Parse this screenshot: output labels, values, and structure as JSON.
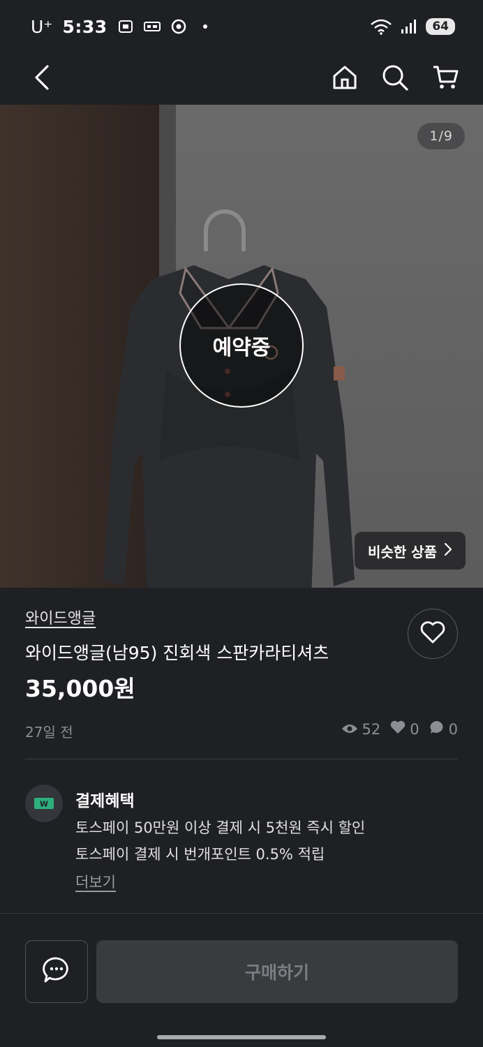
{
  "status_bar": {
    "carrier": "U⁺",
    "time": "5:33",
    "battery": "64"
  },
  "nav": {
    "back_icon": "chevron-left-icon",
    "home_icon": "home-icon",
    "search_icon": "search-icon",
    "cart_icon": "cart-icon"
  },
  "gallery": {
    "counter": "1/9",
    "status_overlay": "예약중",
    "similar_button": "비슷한 상품"
  },
  "product": {
    "brand": "와이드앵글",
    "title": "와이드앵글(남95) 진회색 스판카라티셔츠",
    "price": "35,000원",
    "posted": "27일 전",
    "views": "52",
    "likes": "0",
    "chats": "0"
  },
  "benefits": {
    "title": "결제혜택",
    "line1": "토스페이 50만원 이상 결제 시 5천원 즉시 할인",
    "line2": "토스페이 결제 시 번개포인트 0.5% 적립",
    "more": "더보기"
  },
  "actions": {
    "buy": "구매하기"
  },
  "colors": {
    "background": "#1f2024",
    "muted": "#8d8e93",
    "buy_disabled": "#3a3b3f"
  }
}
